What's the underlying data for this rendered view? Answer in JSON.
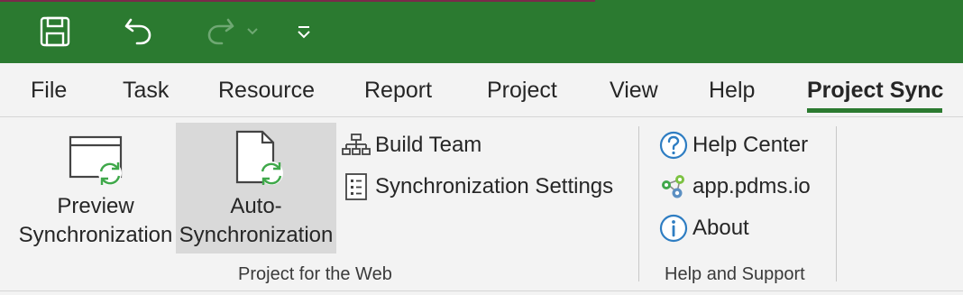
{
  "quick_access": {
    "save_icon": "save-icon",
    "undo_icon": "undo-icon",
    "redo_icon": "redo-icon",
    "customize_icon": "customize-qat-icon"
  },
  "tabs": [
    {
      "label": "File"
    },
    {
      "label": "Task"
    },
    {
      "label": "Resource"
    },
    {
      "label": "Report"
    },
    {
      "label": "Project"
    },
    {
      "label": "View"
    },
    {
      "label": "Help"
    },
    {
      "label": "Project Sync",
      "active": true
    }
  ],
  "ribbon": {
    "groups": [
      {
        "label": "Project for the Web",
        "preview": {
          "line1": "Preview",
          "line2": "Synchronization"
        },
        "auto": {
          "line1": "Auto-",
          "line2": "Synchronization"
        },
        "build_team": "Build Team",
        "sync_settings": "Synchronization Settings"
      },
      {
        "label": "Help and Support",
        "help_center": "Help Center",
        "website": "app.pdms.io",
        "about": "About"
      }
    ]
  },
  "colors": {
    "accent": "#2b7a30",
    "sync_green": "#3fa84a",
    "info_blue": "#2e7dc2"
  }
}
